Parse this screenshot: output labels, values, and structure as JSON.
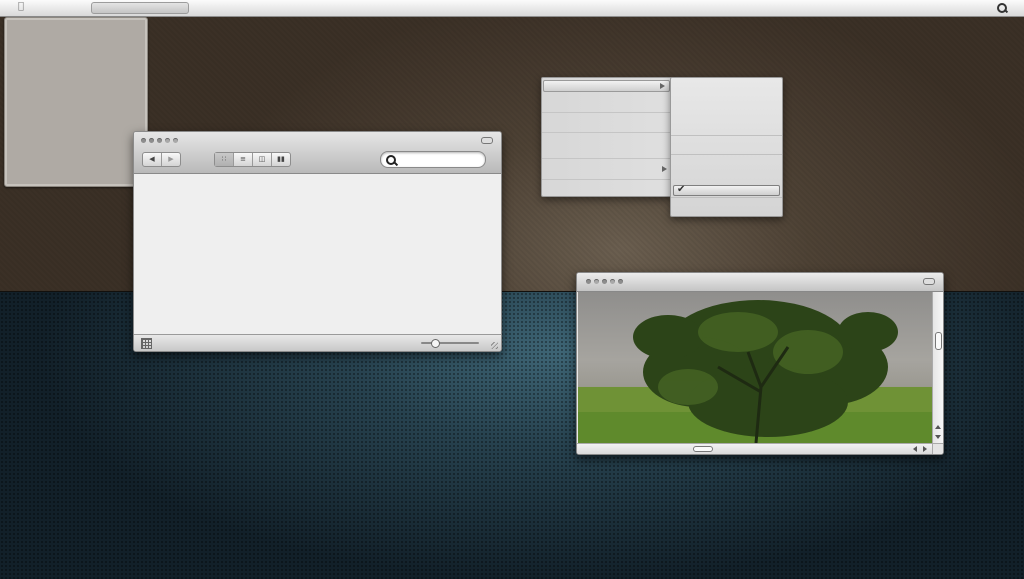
{
  "menubar": {
    "apple_icon": "apple-logo",
    "spotlight_icon": "magnifier-icon"
  },
  "finder": {
    "nav": {
      "back_icon": "back-arrow-icon",
      "forward_icon": "forward-arrow-icon"
    },
    "view_modes": [
      {
        "icon": "icon-view-icon",
        "active": true
      },
      {
        "icon": "list-view-icon",
        "active": false
      },
      {
        "icon": "column-view-icon",
        "active": false
      },
      {
        "icon": "coverflow-view-icon",
        "active": false
      }
    ],
    "search": {
      "value": "",
      "placeholder": ""
    },
    "status": {
      "icon_size": 0.2
    }
  },
  "menus": {
    "primary_items": 6,
    "submenu_checked_item": "check-icon"
  },
  "preview": {
    "vertical_scroll": 0.33,
    "horizontal_scroll": 0.35
  },
  "colors": {
    "wallpaper_top": "#4e4235",
    "wallpaper_bottom": "#27424f",
    "window_chrome": "#c4c4c4"
  }
}
